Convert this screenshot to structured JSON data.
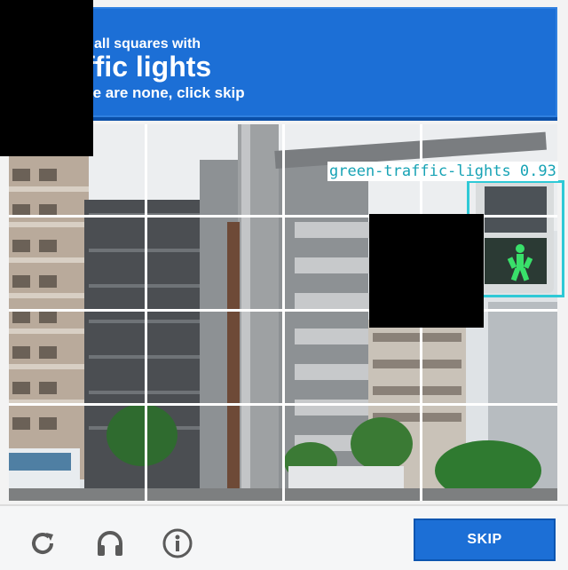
{
  "header": {
    "line1": "all squares with",
    "line2": "ffic lights",
    "line3": "re are none, click skip"
  },
  "detection": {
    "label": "green-traffic-lights 0.93"
  },
  "footer": {
    "skip_label": "SKIP",
    "reload_icon": "reload-icon",
    "audio_icon": "headphones-icon",
    "info_icon": "info-icon"
  },
  "colors": {
    "accent": "#1c6fd6",
    "detection": "#2fc9d6"
  }
}
